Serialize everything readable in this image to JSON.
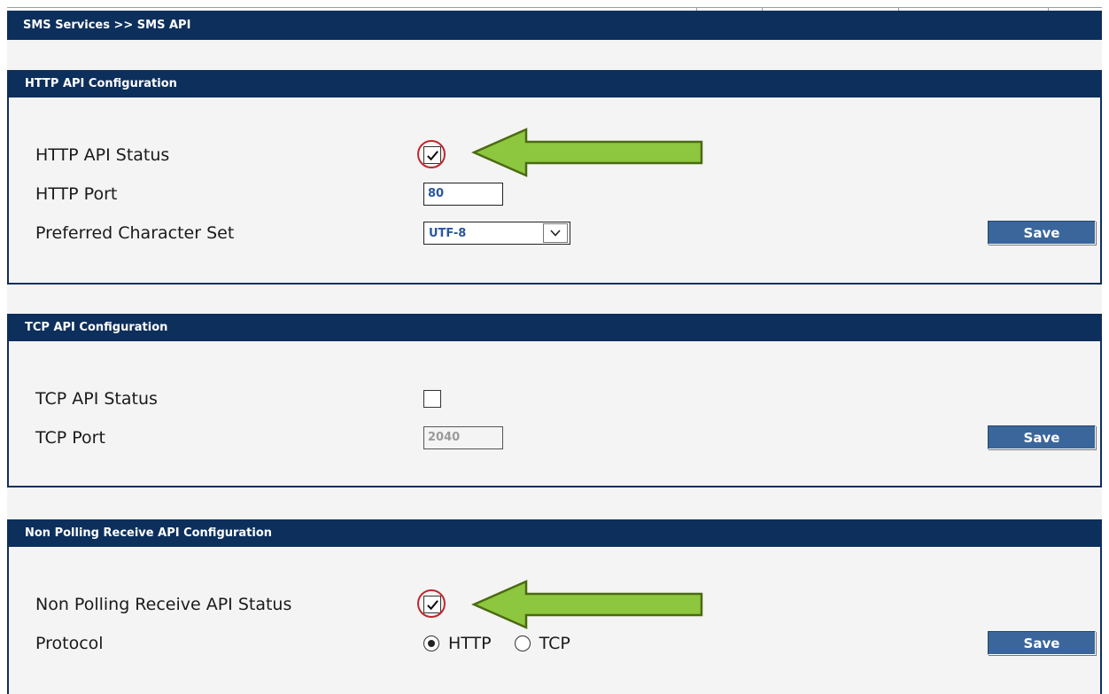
{
  "page_header": {
    "breadcrumb": "SMS Services >> SMS API"
  },
  "sections": {
    "http": {
      "title": "HTTP API Configuration",
      "status_label": "HTTP API Status",
      "status_checked": true,
      "port_label": "HTTP Port",
      "port_value": "80",
      "charset_label": "Preferred Character Set",
      "charset_value": "UTF-8",
      "save_label": "Save"
    },
    "tcp": {
      "title": "TCP API Configuration",
      "status_label": "TCP API Status",
      "status_checked": false,
      "port_label": "TCP Port",
      "port_value": "2040",
      "save_label": "Save"
    },
    "non_polling": {
      "title": "Non Polling Receive API Configuration",
      "status_label": "Non Polling Receive API Status",
      "status_checked": true,
      "protocol_label": "Protocol",
      "protocol_options": [
        "HTTP",
        "TCP"
      ],
      "protocol_selected": "HTTP",
      "save_label": "Save"
    }
  },
  "annotations": {
    "arrow_color": "#8dc63f",
    "arrow_border": "#4a6a10",
    "ring_color": "#c0272d"
  },
  "colors": {
    "header_bg": "#0d2f5c",
    "panel_bg": "#f4f4f4",
    "button_bg": "#3a669c",
    "input_text": "#2a56a0"
  }
}
